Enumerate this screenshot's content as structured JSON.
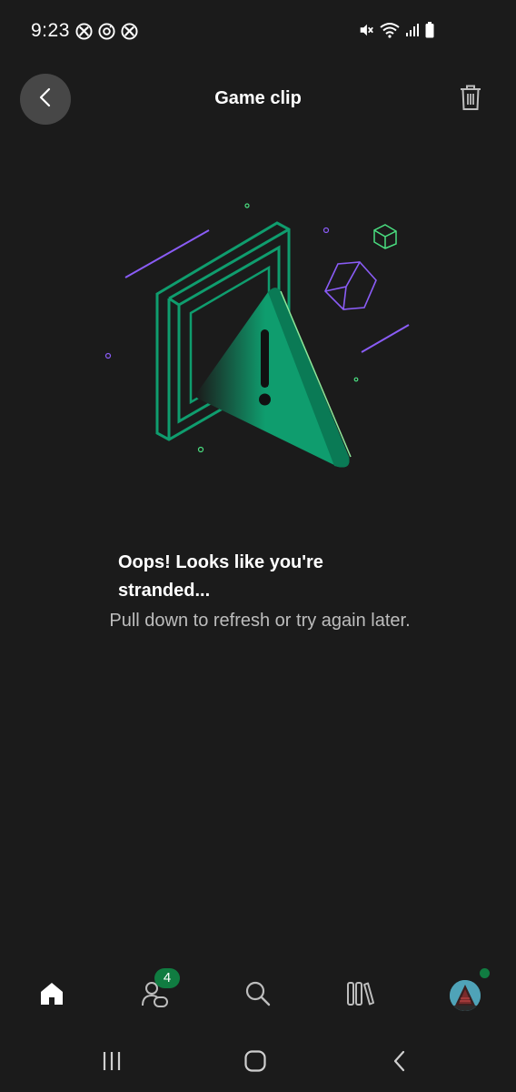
{
  "status_bar": {
    "time": "9:23",
    "left_icons": [
      "xbox-icon",
      "xbox-sync-icon",
      "xbox-icon"
    ],
    "right_icons": [
      "mute-icon",
      "wifi-icon",
      "signal-icon",
      "battery-icon"
    ]
  },
  "header": {
    "title": "Game clip",
    "back_icon": "chevron-left-icon",
    "delete_icon": "trash-icon"
  },
  "error": {
    "heading": "Oops! Looks like you're stranded...",
    "message": "Pull down to refresh or try again later."
  },
  "bottom_nav": {
    "items": [
      {
        "icon": "home-icon"
      },
      {
        "icon": "friends-icon",
        "badge": "4"
      },
      {
        "icon": "search-icon"
      },
      {
        "icon": "library-icon"
      },
      {
        "icon": "profile-avatar"
      }
    ]
  },
  "system_nav": {
    "icons": [
      "recent-apps-icon",
      "home-circle-icon",
      "back-arrow-icon"
    ]
  },
  "colors": {
    "background": "#1b1b1b",
    "accent_green": "#107c41",
    "illustration_green": "#0f9d6e",
    "illustration_purple": "#8a5cf6",
    "back_button_bg": "#474747",
    "secondary_text": "#bdbdbd"
  }
}
